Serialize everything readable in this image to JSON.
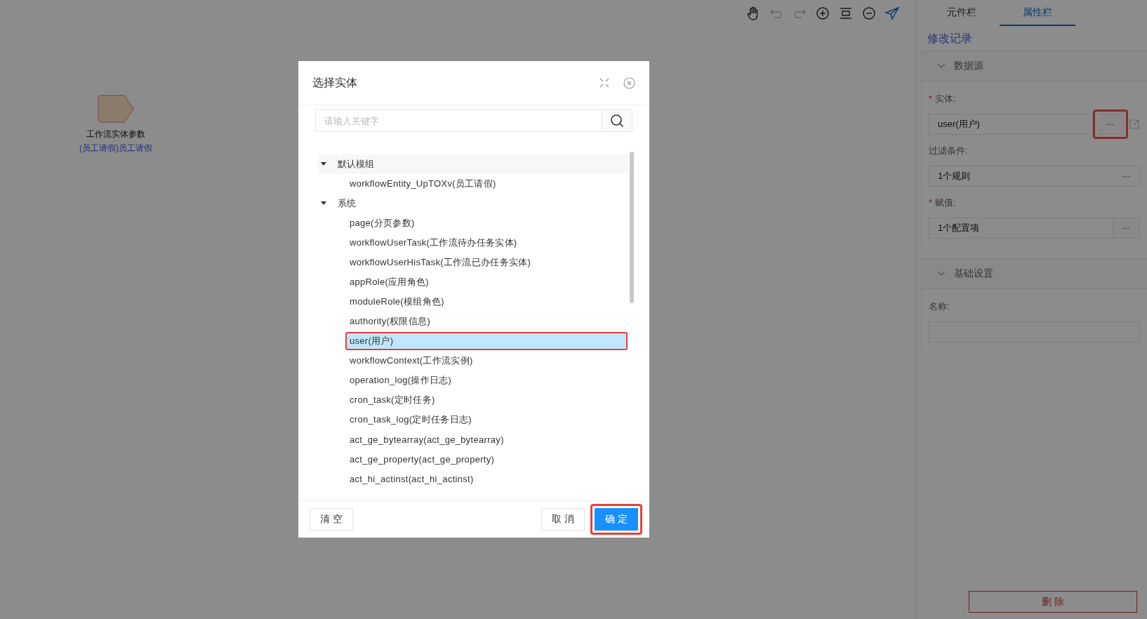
{
  "toolbar": {
    "icons": [
      {
        "kind": "hand",
        "disabled": false
      },
      {
        "kind": "undo",
        "disabled": true
      },
      {
        "kind": "redo",
        "disabled": true
      },
      {
        "kind": "zoom-in",
        "disabled": false
      },
      {
        "kind": "fit",
        "disabled": false
      },
      {
        "kind": "zoom-out",
        "disabled": false
      },
      {
        "kind": "send",
        "disabled": false
      }
    ]
  },
  "canvas_node": {
    "title": "工作流实体参数",
    "subtitle": "(员工请假)员工请假"
  },
  "panel": {
    "tabs": [
      {
        "label": "元件栏",
        "selected": false
      },
      {
        "label": "属性栏",
        "selected": true
      }
    ],
    "history_link": "修改记录",
    "sections": [
      {
        "title": "数据源",
        "expanded": true,
        "fields": [
          {
            "required_mark": "*",
            "label": "实体:",
            "value": "user(用户)",
            "kind": "picker-link",
            "button": "···",
            "highlighted": true
          },
          {
            "label": "过滤条件:",
            "value": "1个规则",
            "kind": "picker-inline",
            "button": "···"
          },
          {
            "required_mark": "*",
            "label": "赋值:",
            "value": "1个配置项",
            "kind": "picker",
            "button": "···"
          }
        ]
      },
      {
        "title": "基础设置",
        "expanded": true,
        "fields": [
          {
            "label": "名称:",
            "kind": "text"
          }
        ]
      }
    ],
    "delete_button": "删 除"
  },
  "dialog": {
    "title": "选择实体",
    "search_placeholder": "请输入关键字",
    "tree": [
      {
        "label": "默认模组",
        "expanded": true,
        "children": [
          {
            "label": "workflowEntity_UpTOXv(员工请假)",
            "selected": false,
            "highlighted": false
          }
        ]
      },
      {
        "label": "系统",
        "expanded": true,
        "children": [
          {
            "label": "page(分页参数)",
            "selected": false,
            "highlighted": false
          },
          {
            "label": "workflowUserTask(工作流待办任务实体)",
            "selected": false,
            "highlighted": false
          },
          {
            "label": "workflowUserHisTask(工作流已办任务实体)",
            "selected": false,
            "highlighted": false
          },
          {
            "label": "appRole(应用角色)",
            "selected": false,
            "highlighted": false
          },
          {
            "label": "moduleRole(模组角色)",
            "selected": false,
            "highlighted": false
          },
          {
            "label": "authority(权限信息)",
            "selected": false,
            "highlighted": false
          },
          {
            "label": "user(用户)",
            "selected": true,
            "highlighted": true
          },
          {
            "label": "workflowContext(工作流实例)",
            "selected": false,
            "highlighted": false
          },
          {
            "label": "operation_log(操作日志)",
            "selected": false,
            "highlighted": false
          },
          {
            "label": "cron_task(定时任务)",
            "selected": false,
            "highlighted": false
          },
          {
            "label": "cron_task_log(定时任务日志)",
            "selected": false,
            "highlighted": false
          },
          {
            "label": "act_ge_bytearray(act_ge_bytearray)",
            "selected": false,
            "highlighted": false
          },
          {
            "label": "act_ge_property(act_ge_property)",
            "selected": false,
            "highlighted": false
          },
          {
            "label": "act_hi_actinst(act_hi_actinst)",
            "selected": false,
            "highlighted": false
          }
        ]
      }
    ],
    "buttons": {
      "clear": "清 空",
      "cancel": "取 消",
      "confirm": "确 定",
      "confirm_highlighted": true
    }
  }
}
